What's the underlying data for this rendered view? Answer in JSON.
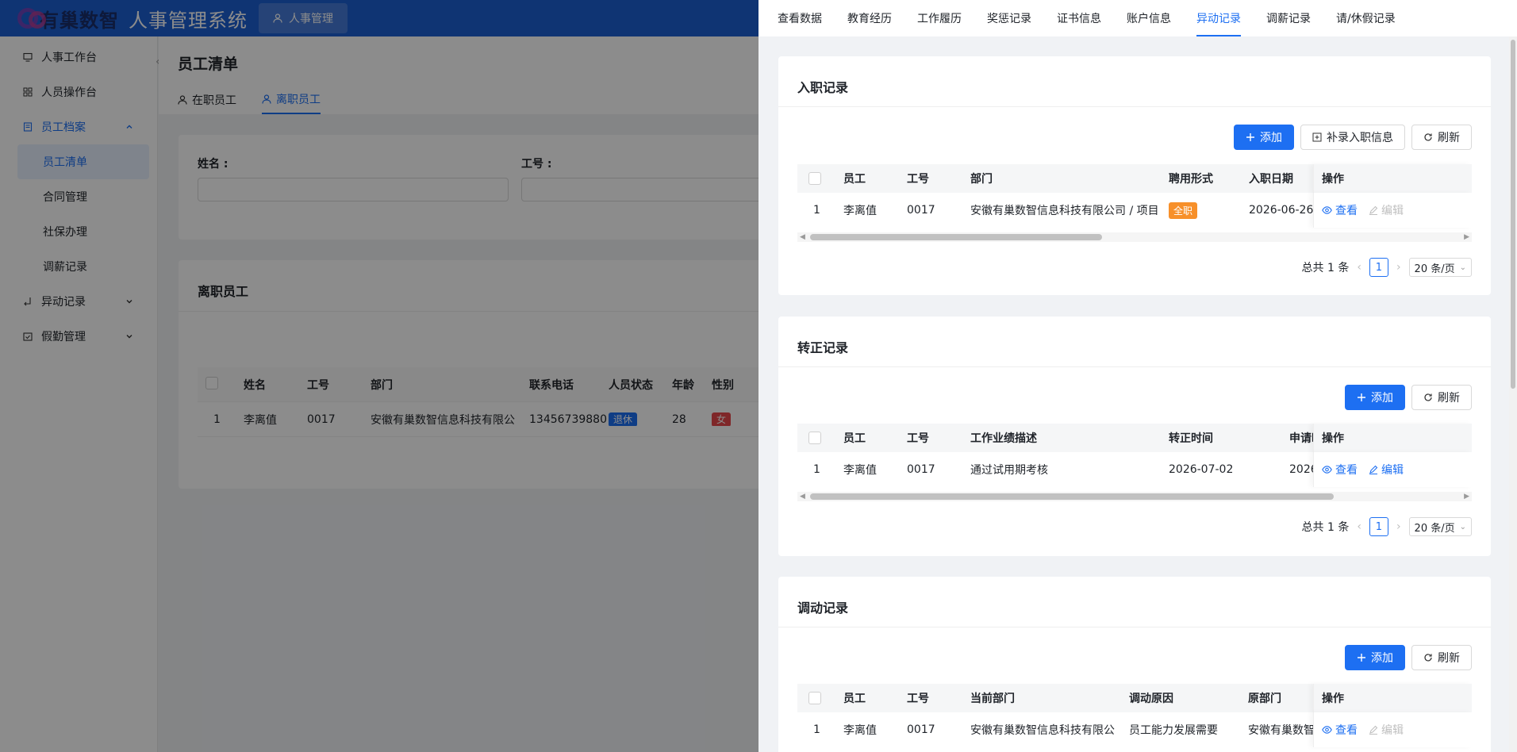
{
  "app": {
    "logo_text": "有巢数智",
    "system_title": "人事管理系统",
    "module_tab": "人事管理"
  },
  "sidebar": {
    "items": [
      {
        "label": "人事工作台",
        "icon": "monitor-icon"
      },
      {
        "label": "人员操作台",
        "icon": "grid-icon"
      },
      {
        "label": "员工档案",
        "icon": "archive-icon"
      },
      {
        "label": "员工清单"
      },
      {
        "label": "合同管理"
      },
      {
        "label": "社保办理"
      },
      {
        "label": "调薪记录"
      },
      {
        "label": "异动记录",
        "icon": "transfer-icon"
      },
      {
        "label": "假勤管理",
        "icon": "calendar-check-icon"
      }
    ]
  },
  "page": {
    "title": "员工清单",
    "tabs": [
      "在职员工",
      "离职员工"
    ],
    "filter": {
      "name_label": "姓名 :",
      "id_label": "工号 :"
    },
    "list_title": "离职员工",
    "table": {
      "headers": [
        "姓名",
        "工号",
        "部门",
        "联系电话",
        "人员状态",
        "年龄",
        "性别"
      ],
      "row": {
        "index": "1",
        "name": "李离值",
        "id": "0017",
        "dept": "安徽有巢数智信息科技有限公",
        "phone": "13456739880",
        "status": "退休",
        "age": "28",
        "gender": "女"
      }
    }
  },
  "drawer": {
    "tabs": [
      "查看数据",
      "教育经历",
      "工作履历",
      "奖惩记录",
      "证书信息",
      "账户信息",
      "异动记录",
      "调薪记录",
      "请/休假记录"
    ],
    "active_tab": "异动记录",
    "sections": {
      "entry": {
        "title": "入职记录",
        "buttons": {
          "add": "添加",
          "supplement": "补录入职信息",
          "refresh": "刷新"
        },
        "headers": [
          "员工",
          "工号",
          "部门",
          "聘用形式",
          "入职日期",
          "操作"
        ],
        "row": {
          "index": "1",
          "employee": "李离值",
          "id": "0017",
          "dept": "安徽有巢数智信息科技有限公司 / 项目",
          "form": "全职",
          "date": "2026-06-26",
          "view": "查看",
          "edit": "编辑"
        },
        "pager": {
          "total": "总共 1 条",
          "page": "1",
          "size": "20 条/页"
        }
      },
      "regular": {
        "title": "转正记录",
        "buttons": {
          "add": "添加",
          "refresh": "刷新"
        },
        "headers": [
          "员工",
          "工号",
          "工作业绩描述",
          "转正时间",
          "申请时",
          "操作"
        ],
        "row": {
          "index": "1",
          "employee": "李离值",
          "id": "0017",
          "desc": "通过试用期考核",
          "date": "2026-07-02",
          "apply": "2026-",
          "view": "查看",
          "edit": "编辑"
        },
        "pager": {
          "total": "总共 1 条",
          "page": "1",
          "size": "20 条/页"
        }
      },
      "transfer": {
        "title": "调动记录",
        "buttons": {
          "add": "添加",
          "refresh": "刷新"
        },
        "headers": [
          "员工",
          "工号",
          "当前部门",
          "调动原因",
          "原部门",
          "操作"
        ],
        "row": {
          "index": "1",
          "employee": "李离值",
          "id": "0017",
          "current": "安徽有巢数智信息科技有限公",
          "reason": "员工能力发展需要",
          "origin": "安徽有巢数智",
          "view": "查看",
          "edit": "编辑"
        }
      }
    }
  },
  "colors": {
    "primary": "#1d6ff2",
    "topbar": "#1d5fd1",
    "orange_tag": "#f7902a",
    "red_tag": "#e8474c"
  }
}
